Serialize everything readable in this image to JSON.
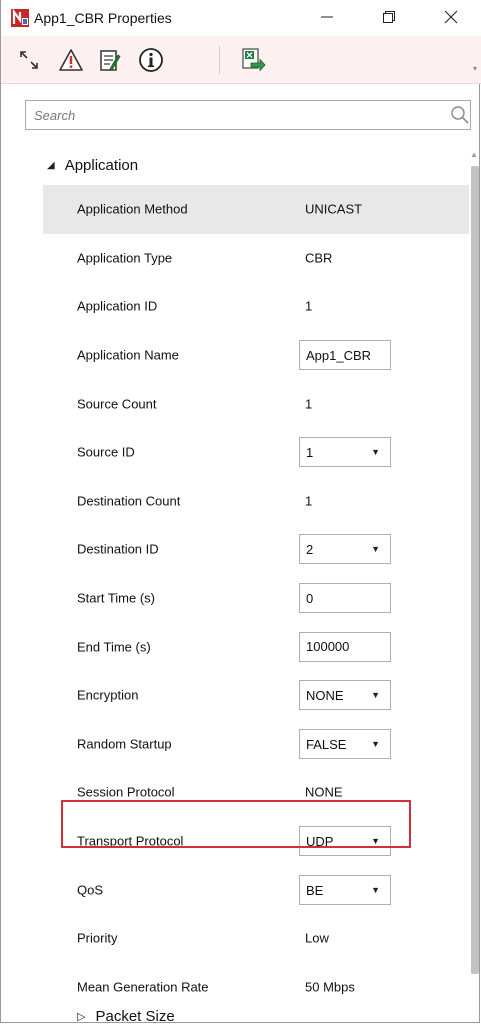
{
  "window": {
    "title": "App1_CBR Properties"
  },
  "title_controls": {
    "minimize": "─",
    "maximize": "⧉",
    "close": "✕"
  },
  "toolbar": {
    "icons": [
      "expand-collapse-icon",
      "warning-icon",
      "notes-icon",
      "info-icon",
      "export-excel-icon"
    ]
  },
  "search": {
    "placeholder": "Search",
    "value": ""
  },
  "group": {
    "title": "Application",
    "expanded": true
  },
  "properties": [
    {
      "label": "Application Method",
      "value": "UNICAST",
      "control": "text",
      "selected": true
    },
    {
      "label": "Application Type",
      "value": "CBR",
      "control": "text"
    },
    {
      "label": "Application ID",
      "value": "1",
      "control": "text"
    },
    {
      "label": "Application Name",
      "value": "App1_CBR",
      "control": "input"
    },
    {
      "label": "Source Count",
      "value": "1",
      "control": "text"
    },
    {
      "label": "Source ID",
      "value": "1",
      "control": "select"
    },
    {
      "label": "Destination Count",
      "value": "1",
      "control": "text"
    },
    {
      "label": "Destination ID",
      "value": "2",
      "control": "select"
    },
    {
      "label": "Start Time (s)",
      "value": "0",
      "control": "input"
    },
    {
      "label": "End Time (s)",
      "value": "100000",
      "control": "input"
    },
    {
      "label": "Encryption",
      "value": "NONE",
      "control": "select"
    },
    {
      "label": "Random Startup",
      "value": "FALSE",
      "control": "select"
    },
    {
      "label": "Session Protocol",
      "value": "NONE",
      "control": "text"
    },
    {
      "label": "Transport Protocol",
      "value": "UDP",
      "control": "select",
      "highlighted": true
    },
    {
      "label": "QoS",
      "value": "BE",
      "control": "select"
    },
    {
      "label": "Priority",
      "value": "Low",
      "control": "text"
    },
    {
      "label": "Mean Generation Rate",
      "value": "50 Mbps",
      "control": "text"
    }
  ],
  "sub_group": {
    "title": "Packet Size",
    "expanded": false
  },
  "colors": {
    "toolbar_bg": "#fdf0f0",
    "highlight_border": "#d32f3a",
    "selected_row": "#e8e8e8"
  }
}
